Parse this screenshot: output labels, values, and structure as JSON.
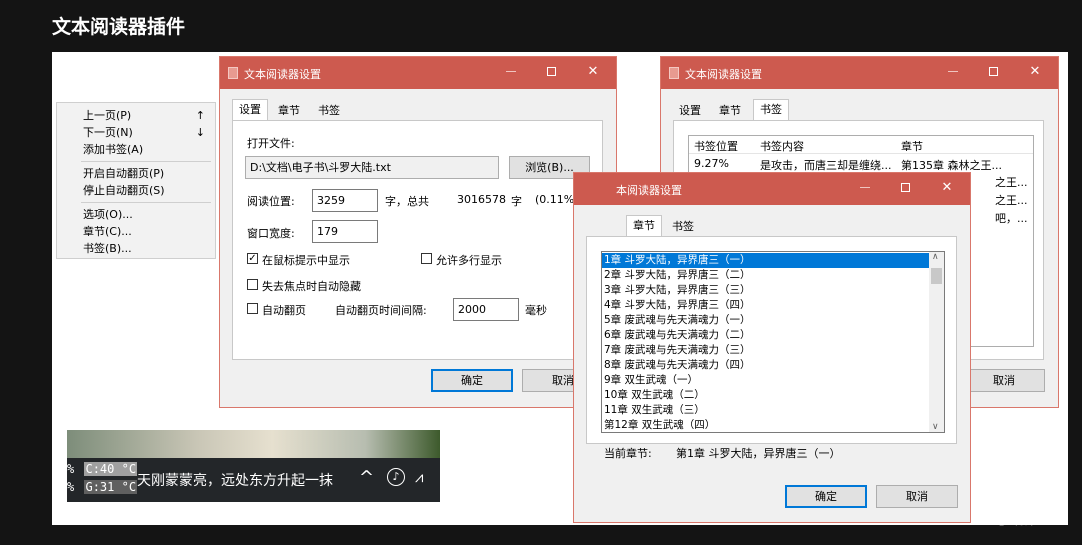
{
  "page": {
    "heading": "文本阅读器插件"
  },
  "context_menu": {
    "items": [
      {
        "label": "上一页(P)",
        "key": "↑"
      },
      {
        "label": "下一页(N)",
        "key": "↓"
      },
      {
        "label": "添加书签(A)",
        "key": ""
      },
      {
        "label": "开启自动翻页(P)",
        "key": ""
      },
      {
        "label": "停止自动翻页(S)",
        "key": ""
      },
      {
        "label": "选项(O)...",
        "key": ""
      },
      {
        "label": "章节(C)...",
        "key": ""
      },
      {
        "label": "书签(B)...",
        "key": ""
      }
    ]
  },
  "settings_window": {
    "title": "文本阅读器设置",
    "tabs": [
      "设置",
      "章节",
      "书签"
    ],
    "open_file_label": "打开文件:",
    "file_path": "D:\\文档\\电子书\\斗罗大陆.txt",
    "browse_label": "浏览(B)...",
    "read_position_label": "阅读位置:",
    "read_position_value": "3259",
    "char_total_label": "字，总共",
    "total_chars": "3016578",
    "char_unit": "字",
    "percent": "(0.11%)",
    "window_width_label": "窗口宽度:",
    "window_width_value": "179",
    "cb_mouse_tip": "在鼠标提示中显示",
    "cb_multiline": "允许多行显示",
    "cb_autohide": "失去焦点时自动隐藏",
    "cb_autopage": "自动翻页",
    "autopage_interval_label": "自动翻页时间间隔:",
    "autopage_interval_value": "2000",
    "ms_label": "毫秒",
    "ok_label": "确定",
    "cancel_label": "取消"
  },
  "bookmark_window": {
    "title": "文本阅读器设置",
    "tabs": [
      "设置",
      "章节",
      "书签"
    ],
    "columns": [
      "书签位置",
      "书签内容",
      "章节"
    ],
    "rows": [
      {
        "pos": "9.27%",
        "content": "是攻击，而唐三却是缠绕...",
        "chapter": "第135章 森林之王..."
      }
    ],
    "overflow_fragments": [
      "之王...",
      "之王...",
      "吧，..."
    ],
    "cancel_label": "取消"
  },
  "chapter_window": {
    "title": "本阅读器设置",
    "tabs": [
      "章节",
      "书签"
    ],
    "chapters": [
      "1章 斗罗大陆，异界唐三（一）",
      "2章 斗罗大陆，异界唐三（二）",
      "3章 斗罗大陆，异界唐三（三）",
      "4章 斗罗大陆，异界唐三（四）",
      "5章 废武魂与先天满魂力（一）",
      "6章 废武魂与先天满魂力（二）",
      "7章 废武魂与先天满魂力（三）",
      "8章 废武魂与先天满魂力（四）",
      "9章 双生武魂（一）",
      "10章 双生武魂（二）",
      "11章 双生武魂（三）",
      "第12章 双生武魂（四）"
    ],
    "current_label": "当前章节:",
    "current_value": "第1章 斗罗大陆，异界唐三（一）",
    "ok_label": "确定",
    "cancel_label": "取消"
  },
  "taskbar_widget": {
    "cpu_pct": "%",
    "gpu_pct": "%",
    "cpu_temp": "C:40 °C",
    "gpu_temp": "G:31 °C",
    "reading_text": "天刚蒙蒙亮，远处东方升起一抹"
  },
  "watermark": "小黑盒",
  "colors": {
    "titlebar": "#cd5a4f",
    "selection": "#0078d7",
    "window_bg": "#f0f0f0"
  }
}
